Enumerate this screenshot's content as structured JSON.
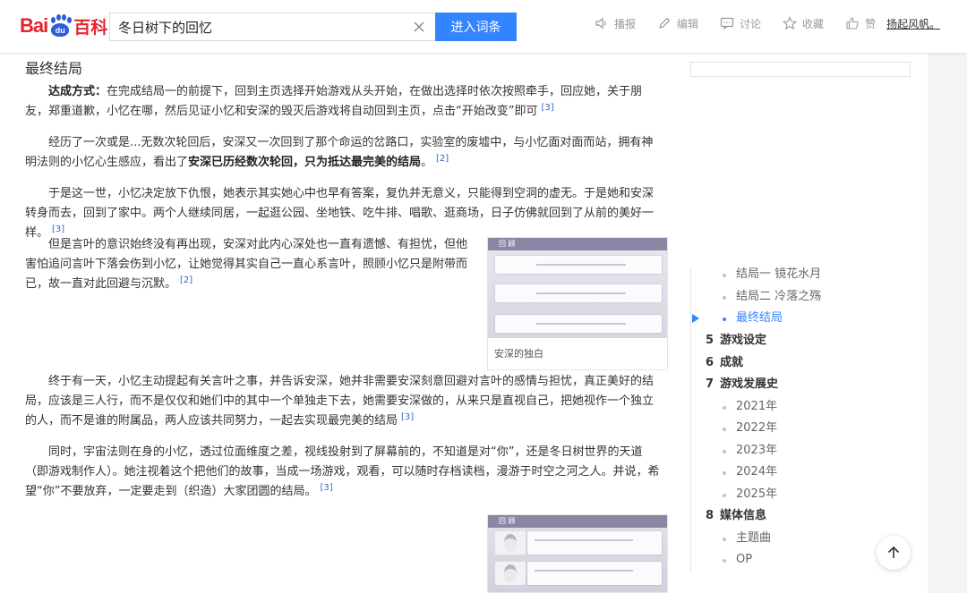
{
  "header": {
    "logo": {
      "bai": "Bai",
      "du": "du",
      "baike": "百科"
    },
    "search": {
      "value": "冬日树下的回忆"
    },
    "search_button": "进入词条",
    "actions": [
      {
        "icon": "speaker-icon",
        "label": "播报"
      },
      {
        "icon": "pencil-icon",
        "label": "编辑"
      },
      {
        "icon": "comment-icon",
        "label": "讨论"
      },
      {
        "icon": "star-icon",
        "label": "收藏"
      },
      {
        "icon": "thumbs-up-icon",
        "label": "赞"
      }
    ],
    "user": "扬起风帆。"
  },
  "article": {
    "section_title": "最终结局",
    "p1": {
      "lead": "达成方式：",
      "text": "在完成结局一的前提下，回到主页选择开始游戏从头开始，在做出选择时依次按照牵手，回应她，关于朋友，郑重道歉，小忆在哪，然后见证小忆和安深的毁灭后游戏将自动回到主页，点击“开始改变”即可",
      "ref": "[3]"
    },
    "p2": {
      "text": "经历了一次或是...无数次轮回后，安深又一次回到了那个命运的岔路口，实验室的废墟中，与小忆面对面而站，拥有神明法则的小忆心生感应，看出了",
      "bold": "安深已历经数次轮回，只为抵达最完美的结局",
      "tail": "。",
      "ref": "[2]"
    },
    "p3": {
      "text": "于是这一世，小忆决定放下仇恨，她表示其实她心中也早有答案，复仇并无意义，只能得到空洞的虚无。于是她和安深转身而去，回到了家中。两个人继续同居，一起逛公园、坐地铁、吃牛排、唱歌、逛商场，日子仿佛就回到了从前的美好一样。",
      "ref": "[3]"
    },
    "p4": {
      "text": "但是言叶的意识始终没有再出现，安深对此内心深处也一直有遗憾、有担忧，但他害怕追问言叶下落会伤到小忆，让她觉得其实自己一直心系言叶，照顾小忆只是附带而已，故一直对此回避与沉默。",
      "ref": "[2]"
    },
    "p5": {
      "text": "终于有一天，小忆主动提起有关言叶之事，并告诉安深，她并非需要安深刻意回避对言叶的感情与担忧，真正美好的结局，应该是三人行，而不是仅仅和她们中的其中一个单独走下去，她需要安深做的，从来只是直视自己，把她视作一个独立的人，而不是谁的附属品，两人应该共同努力，一起去实现最完美的结局",
      "ref": "[3]"
    },
    "p6": {
      "text": "同时，宇宙法则在身的小忆，透过位面维度之差，视线投射到了屏幕前的，不知道是对“你”，还是冬日树世界的天道（即游戏制作人）。她注视着这个把他们的故事，当成一场游戏，观看，可以随时存档读档，漫游于时空之河之人。并说，希望“你”不要放弃，一定要走到（织造）大家团圆的结局。",
      "ref": "[3]"
    },
    "figure1": {
      "bar": "回 顾",
      "caption": "安深的独白"
    },
    "figure2": {
      "bar": "回 顾",
      "speaker": "小忆"
    }
  },
  "toc": {
    "items": [
      {
        "type": "sub",
        "label": "结局一 镜花水月"
      },
      {
        "type": "sub",
        "label": "结局二 冷落之殇"
      },
      {
        "type": "sub",
        "label": "最终结局",
        "active": true
      },
      {
        "type": "main",
        "num": "5",
        "label": "游戏设定"
      },
      {
        "type": "main",
        "num": "6",
        "label": "成就"
      },
      {
        "type": "main",
        "num": "7",
        "label": "游戏发展史"
      },
      {
        "type": "sub",
        "label": "2021年"
      },
      {
        "type": "sub",
        "label": "2022年"
      },
      {
        "type": "sub",
        "label": "2023年"
      },
      {
        "type": "sub",
        "label": "2024年"
      },
      {
        "type": "sub",
        "label": "2025年"
      },
      {
        "type": "main",
        "num": "8",
        "label": "媒体信息"
      },
      {
        "type": "sub",
        "label": "主题曲"
      },
      {
        "type": "sub",
        "label": "OP"
      }
    ]
  },
  "colors": {
    "accent": "#3385ff",
    "brand_red": "#e4252c",
    "brand_blue": "#2a5fd6",
    "ref_link": "#3366cc"
  }
}
